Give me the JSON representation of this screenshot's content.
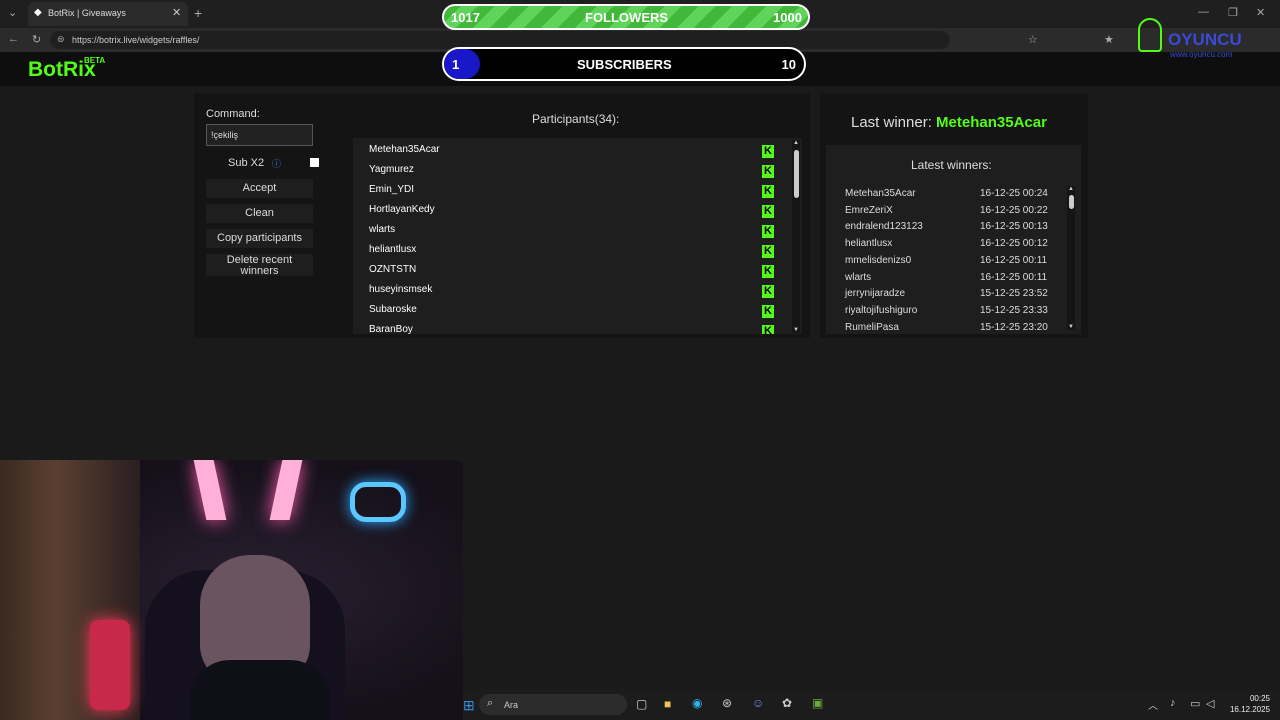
{
  "browser": {
    "tab_title": "BotRix | Giveaways",
    "new_tab": "+",
    "url": "https://botrix.live/widgets/raffles/",
    "window_minimize": "—",
    "window_restore": "❐",
    "window_close": "✕"
  },
  "overlay": {
    "followers_current": "1017",
    "followers_label": "FOLLOWERS",
    "followers_goal": "1000",
    "subscribers_current": "1",
    "subscribers_label": "SUBSCRIBERS",
    "subscribers_goal": "10",
    "subscribers_progress": 0.1,
    "watermark_text": "OYUNCU",
    "watermark_sub": "www.oyuncu.com"
  },
  "header": {
    "logo": "BotRix",
    "beta": "BETA"
  },
  "controls": {
    "command_label": "Command:",
    "command_value": "!çekiliş",
    "sub_x2_label": "Sub X2",
    "info_icon": "ⓘ",
    "accept_label": "Accept",
    "clean_label": "Clean",
    "copy_label": "Copy participants",
    "delete_label_1": "Delete recent",
    "delete_label_2": "winners"
  },
  "participants": {
    "title": "Participants(34):",
    "names": [
      "Metehan35Acar",
      "Yagmurez",
      "Emin_YDI",
      "HortlayanKedy",
      "wlarts",
      "heliantlusx",
      "OZNTSTN",
      "huseyinsmsek",
      "Subaroske",
      "BaranBoy"
    ]
  },
  "winners": {
    "last_winner_label": "Last winner:",
    "last_winner_name": "Metehan35Acar",
    "latest_title": "Latest winners:",
    "rows": [
      {
        "name": "Metehan35Acar",
        "time": "16-12-25 00:24"
      },
      {
        "name": "EmreZeriX",
        "time": "16-12-25 00:22"
      },
      {
        "name": "endralend123123",
        "time": "16-12-25 00:13"
      },
      {
        "name": "heliantlusx",
        "time": "16-12-25 00:12"
      },
      {
        "name": "mmelisdenizs0",
        "time": "16-12-25 00:11"
      },
      {
        "name": "wlarts",
        "time": "16-12-25 00:11"
      },
      {
        "name": "jerrynijaradze",
        "time": "15-12-25 23:52"
      },
      {
        "name": "riyaltojifushiguro",
        "time": "15-12-25 23:33"
      },
      {
        "name": "RumeliPasa",
        "time": "15-12-25 23:20"
      }
    ]
  },
  "taskbar": {
    "search_placeholder": "Ara",
    "time": "00:25",
    "date": "16.12.2025"
  },
  "colors": {
    "kick_green": "#53fc18",
    "sub_blue": "#1818c8"
  }
}
